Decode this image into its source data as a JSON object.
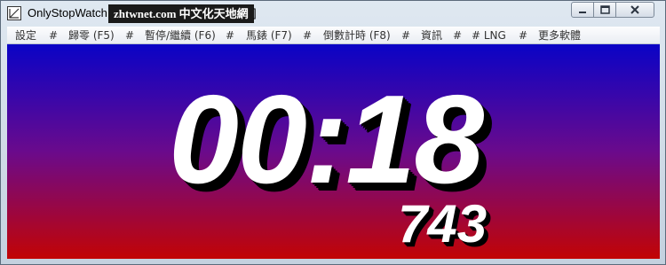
{
  "window": {
    "title": "OnlyStopWatch",
    "watermark": "zhtwnet.com 中文化天地網",
    "title_tail": "]"
  },
  "menu": {
    "items": [
      {
        "label": "設定"
      },
      {
        "label": "#"
      },
      {
        "label": "歸零 (F5)"
      },
      {
        "label": "#"
      },
      {
        "label": "暫停/繼續 (F6)"
      },
      {
        "label": "#"
      },
      {
        "label": "馬錶 (F7)"
      },
      {
        "label": "#"
      },
      {
        "label": "倒數計時 (F8)"
      },
      {
        "label": "#"
      },
      {
        "label": "資訊"
      },
      {
        "label": "#"
      },
      {
        "label": "# LNG"
      },
      {
        "label": "#"
      },
      {
        "label": "更多軟體"
      }
    ]
  },
  "stopwatch": {
    "time": "00:18",
    "milliseconds": "743"
  },
  "colors": {
    "gradient_top": "#0a03c6",
    "gradient_bottom": "#c20404",
    "digits": "#ffffff",
    "shadow": "#000000"
  }
}
